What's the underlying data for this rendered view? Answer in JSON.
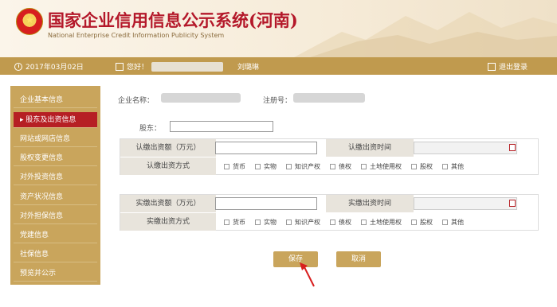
{
  "header": {
    "title_cn": "国家企业信用信息公示系统(河南)",
    "title_en": "National Enterprise Credit Information Publicity System"
  },
  "topbar": {
    "date": "2017年03月02日",
    "greeting": "您好！",
    "user": "刘璐琳",
    "logout": "退出登录"
  },
  "sidebar": {
    "items": [
      {
        "label": "企业基本信息"
      },
      {
        "label": "▸ 股东及出资信息"
      },
      {
        "label": "网站或网店信息"
      },
      {
        "label": "股权变更信息"
      },
      {
        "label": "对外投资信息"
      },
      {
        "label": "资产状况信息"
      },
      {
        "label": "对外担保信息"
      },
      {
        "label": "党建信息"
      },
      {
        "label": "社保信息"
      },
      {
        "label": "预览并公示"
      }
    ]
  },
  "content": {
    "company_label": "企业名称：",
    "reg_label": "注册号：",
    "shareholder_label": "股东：",
    "subscribed": {
      "amount_label": "认缴出资额（万元）",
      "time_label": "认缴出资时间",
      "method_label": "认缴出资方式"
    },
    "paid": {
      "amount_label": "实缴出资额（万元）",
      "time_label": "实缴出资时间",
      "method_label": "实缴出资方式"
    },
    "methods": [
      "货币",
      "实物",
      "知识产权",
      "债权",
      "土地使用权",
      "股权",
      "其他"
    ],
    "save": "保存",
    "cancel": "取消"
  },
  "colors": {
    "brand_red": "#b61f24",
    "gold": "#c9a55c"
  }
}
